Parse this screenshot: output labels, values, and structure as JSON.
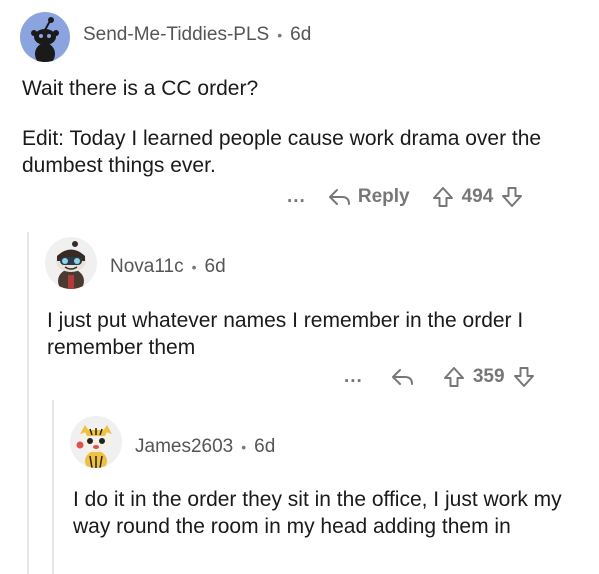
{
  "comments": [
    {
      "username": "Send-Me-Tiddies-PLS",
      "time": "6d",
      "paragraphs": [
        "Wait there is a CC order?",
        "Edit: Today I learned people cause work drama over the dumbest things ever."
      ],
      "actions": {
        "more": "...",
        "reply": "Reply",
        "score": "494"
      },
      "avatar_color": "#8ba4e0"
    },
    {
      "username": "Nova11c",
      "time": "6d",
      "paragraphs": [
        "I just put whatever names I remember in the order I remember them"
      ],
      "actions": {
        "more": "...",
        "score": "359"
      }
    },
    {
      "username": "James2603",
      "time": "6d",
      "paragraphs": [
        "I do it in the order they sit in the office, I just work my way round the room in my head adding them in"
      ]
    }
  ],
  "separator": "•",
  "colors": {
    "text": "#1a1a1b",
    "meta": "#555555",
    "icon": "#777777",
    "thread_line": "#e6e6e6"
  }
}
